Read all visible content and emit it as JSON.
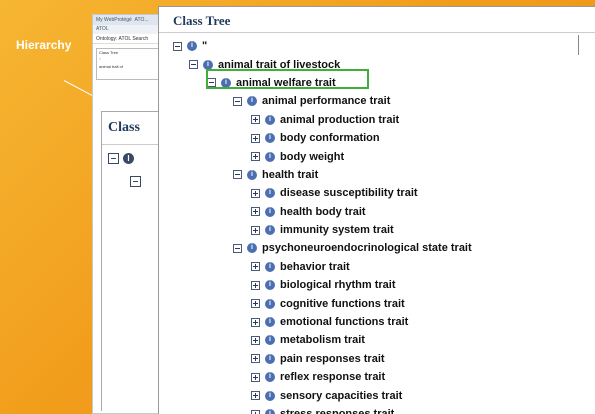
{
  "side_label": "Hierarchy",
  "bg_screenshot": {
    "tabs": [
      "My WebProtégé",
      "ATO..."
    ],
    "subtab": "ATOL",
    "ontology_line": "Ontology: ATOL   Search",
    "panel_title": "Class Tree",
    "panel_lines": [
      "\"",
      "animal trait of"
    ],
    "class_title": "Class"
  },
  "panel": {
    "title": "Class Tree",
    "root_label": "\""
  },
  "tree": [
    {
      "label": "animal trait of livestock",
      "level": 1,
      "expander": "minus"
    },
    {
      "label": "animal welfare trait",
      "level": 2,
      "expander": "minus",
      "highlighted": true
    },
    {
      "label": "animal performance trait",
      "level": 3,
      "expander": "minus"
    },
    {
      "label": "animal production trait",
      "level": 4,
      "expander": "plus"
    },
    {
      "label": "body conformation",
      "level": 4,
      "expander": "plus"
    },
    {
      "label": "body weight",
      "level": 4,
      "expander": "plus"
    },
    {
      "label": "health trait",
      "level": 3,
      "expander": "minus"
    },
    {
      "label": "disease susceptibility trait",
      "level": 4,
      "expander": "plus"
    },
    {
      "label": "health body trait",
      "level": 4,
      "expander": "plus"
    },
    {
      "label": "immunity system trait",
      "level": 4,
      "expander": "plus"
    },
    {
      "label": "psychoneuroendocrinological state trait",
      "level": 3,
      "expander": "minus"
    },
    {
      "label": "behavior trait",
      "level": 4,
      "expander": "plus"
    },
    {
      "label": "biological rhythm trait",
      "level": 4,
      "expander": "plus"
    },
    {
      "label": "cognitive functions trait",
      "level": 4,
      "expander": "plus"
    },
    {
      "label": "emotional functions trait",
      "level": 4,
      "expander": "plus"
    },
    {
      "label": "metabolism trait",
      "level": 4,
      "expander": "plus"
    },
    {
      "label": "pain responses trait",
      "level": 4,
      "expander": "plus"
    },
    {
      "label": "reflex response trait",
      "level": 4,
      "expander": "plus"
    },
    {
      "label": "sensory capacities trait",
      "level": 4,
      "expander": "plus"
    },
    {
      "label": "stress responses trait",
      "level": 4,
      "expander": "plus"
    }
  ],
  "colors": {
    "background": "#f19d1c",
    "highlight": "#3fae3b",
    "title": "#1f3a5c",
    "class_icon": "#4b6fb0"
  }
}
